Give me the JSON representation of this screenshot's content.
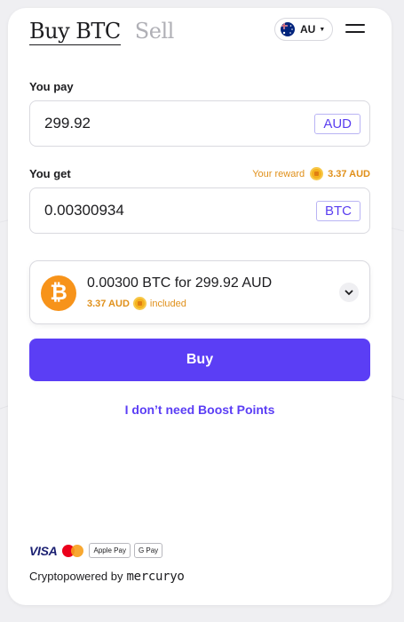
{
  "tabs": {
    "buy_label": "Buy BTC",
    "sell_label": "Sell"
  },
  "country_selector": {
    "code": "AU",
    "flag_icon": "australia-flag-icon"
  },
  "menu": {
    "icon": "hamburger-menu-icon"
  },
  "pay": {
    "label": "You pay",
    "value": "299.92",
    "currency": "AUD"
  },
  "get": {
    "label": "You get",
    "value": "0.00300934",
    "currency": "BTC"
  },
  "reward": {
    "label": "Your reward",
    "amount": "3.37 AUD",
    "icon": "boost-coin-icon"
  },
  "quote": {
    "summary": "0.00300 BTC for 299.92 AUD",
    "reward_amount": "3.37 AUD",
    "included_text": "included",
    "asset_icon": "bitcoin-logo-icon",
    "expand_icon": "chevron-down-icon"
  },
  "buy_button": {
    "label": "Buy"
  },
  "no_boost_link": {
    "label": "I don’t need Boost Points"
  },
  "payment_methods": {
    "visa": "VISA",
    "mastercard_icon": "mastercard-icon",
    "apple_pay": "Apple Pay",
    "google_pay": "G Pay"
  },
  "footer": {
    "text": "Cryptopowered by",
    "brand": "mercuryo"
  },
  "colors": {
    "accent": "#5b3ef5",
    "reward_orange": "#e0901a",
    "bitcoin_orange": "#f7931a",
    "background": "#efeff2"
  }
}
